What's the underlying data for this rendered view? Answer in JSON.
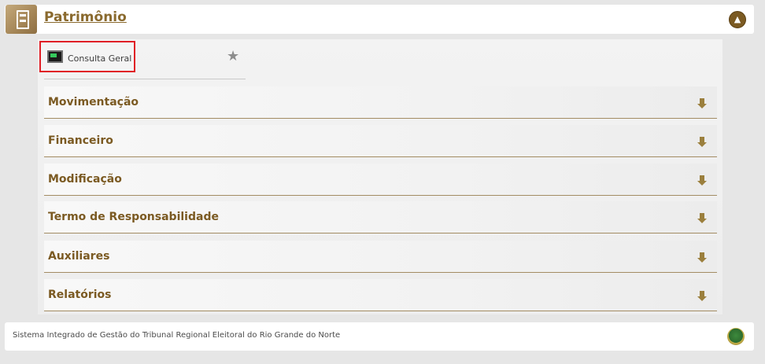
{
  "header": {
    "module_icon": "building-document-icon",
    "title": "Patrimônio",
    "top_button_icon": "arrow-up-circle-icon"
  },
  "quick_access": {
    "icon": "computer-monitor-icon",
    "label": "Consulta Geral",
    "favorite_icon": "star-icon"
  },
  "sections": [
    {
      "label": "Movimentação"
    },
    {
      "label": "Financeiro"
    },
    {
      "label": "Modificação"
    },
    {
      "label": "Termo de Responsabilidade"
    },
    {
      "label": "Auxiliares"
    },
    {
      "label": "Relatórios"
    }
  ],
  "footer": {
    "text": "Sistema Integrado de Gestão do Tribunal Regional Eleitoral do Rio Grande do Norte",
    "emblem_icon": "national-emblem-icon"
  },
  "colors": {
    "brand_brown": "#7b5a22",
    "title_brown": "#8a6a2e",
    "highlight_red": "#e01f26"
  }
}
